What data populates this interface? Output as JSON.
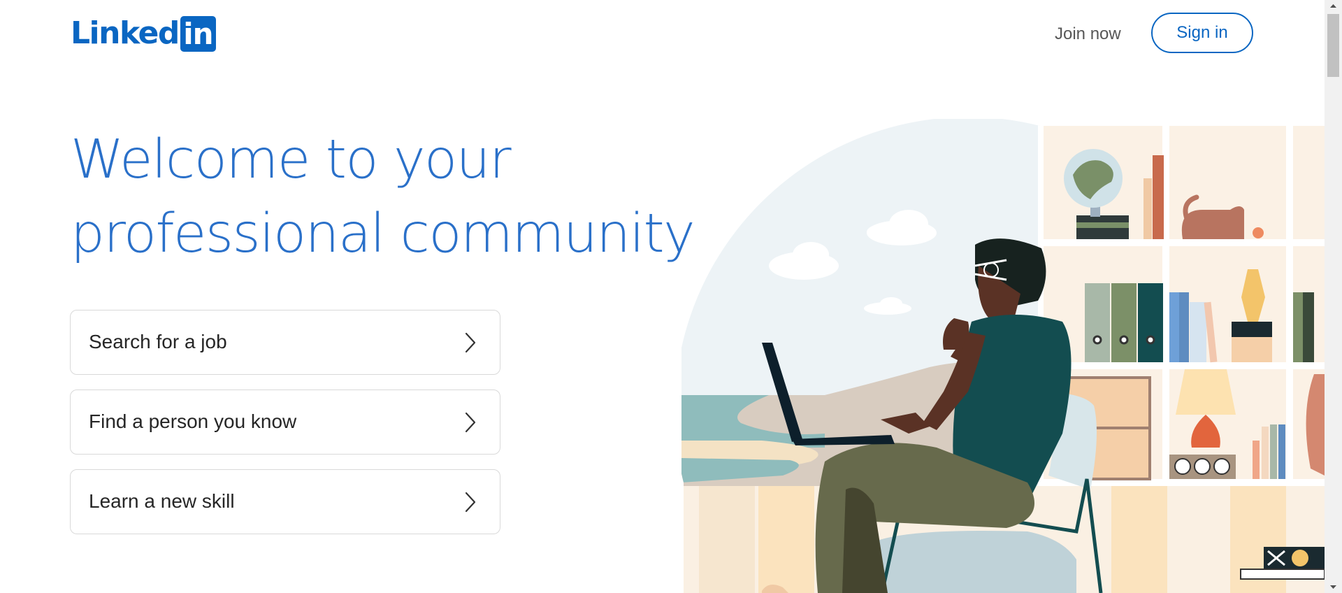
{
  "header": {
    "logo_text": "Linked",
    "logo_box_text": "in",
    "join_label": "Join now",
    "signin_label": "Sign in"
  },
  "hero": {
    "title_line1": "Welcome to your",
    "title_line2": "professional community"
  },
  "actions": [
    {
      "label": "Search for a job",
      "icon": "chevron-right-icon"
    },
    {
      "label": "Find a person you know",
      "icon": "chevron-right-icon"
    },
    {
      "label": "Learn a new skill",
      "icon": "chevron-right-icon"
    }
  ],
  "colors": {
    "brand": "#0a66c2",
    "title": "#2a70c9",
    "text": "#262626",
    "muted": "#575757"
  }
}
